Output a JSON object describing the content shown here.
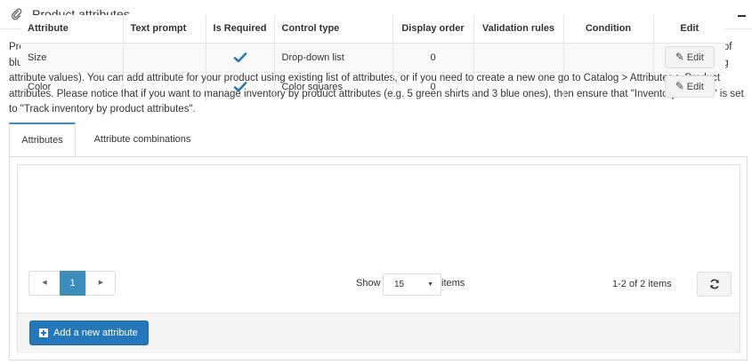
{
  "panel": {
    "title": "Product attributes",
    "icons": {
      "header": "paperclip-icon",
      "collapse": "minus-icon"
    }
  },
  "description": "Product attributes are quantifiable or descriptive aspects of a product (such as, color). For example, if you were to create an attribute for color, with the values of blue, green, yellow, and so on, you may want to apply this attribute to shirts, which you sell in various colors (you can adjust a price or weight for any of existing attribute values). You can add attribute for your product using existing list of attributes, or if you need to create a new one go to Catalog > Attributes > Product attributes. Please notice that if you want to manage inventory by product attributes (e.g. 5 green shirts and 3 blue ones), then ensure that \"Inventory method\" is set to \"Track inventory by product attributes\".",
  "tabs": [
    {
      "label": "Attributes",
      "active": true
    },
    {
      "label": "Attribute combinations",
      "active": false
    }
  ],
  "grid": {
    "columns": [
      "Attribute",
      "Text prompt",
      "Is Required",
      "Control type",
      "Display order",
      "Validation rules",
      "Condition",
      "Edit"
    ],
    "rows": [
      {
        "attribute": "Size",
        "text_prompt": "",
        "is_required": true,
        "control_type": "Drop-down list",
        "display_order": "0",
        "validation_rules": "",
        "condition": "",
        "edit_label": "Edit"
      },
      {
        "attribute": "Color",
        "text_prompt": "",
        "is_required": true,
        "control_type": "Color squares",
        "display_order": "0",
        "validation_rules": "",
        "condition": "",
        "edit_label": "Edit"
      }
    ]
  },
  "pager": {
    "prev_symbol": "◀",
    "current_page": "1",
    "next_symbol": "▶",
    "show_label": "Show",
    "page_size": "15",
    "items_label": "items",
    "range_info": "1-2 of 2 items"
  },
  "actions": {
    "add_label": "Add a new attribute"
  },
  "colors": {
    "accent": "#3c8dbc",
    "primary_button": "#2478b9",
    "check": "#2a7ab9"
  }
}
